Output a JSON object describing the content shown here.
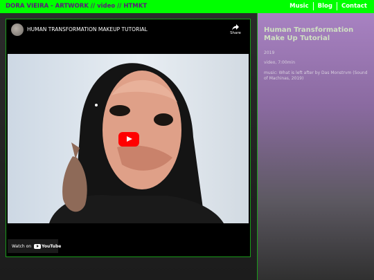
{
  "header": {
    "breadcrumb": [
      "DORA VIEIRA - ARTWORK",
      "video",
      "HTMKT"
    ],
    "separator": " // ",
    "nav": [
      "Music",
      "Blog",
      "Contact"
    ]
  },
  "video": {
    "title": "HUMAN TRANSFORMATION MAKEUP TUTORIAL",
    "share_label": "Share",
    "watch_on_label": "Watch on",
    "youtube_label": "YouTube"
  },
  "info": {
    "title": "Human Transformation Make Up Tutorial",
    "year": "2019",
    "medium": "video, 7:00min",
    "music": "music: What is left after by Das Monstrvm (Sound of Machinas, 2019)"
  },
  "colors": {
    "topbar": "#00ff00",
    "breadcrumb_text": "#5a1a7a",
    "border_accent": "#1a9d1a",
    "youtube_red": "#ff0000"
  }
}
